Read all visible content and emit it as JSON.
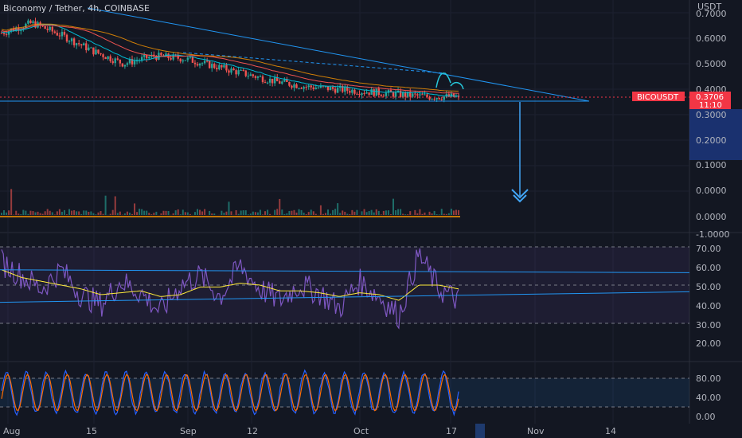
{
  "header": {
    "title": "Biconomy / Tether, 4h, COINBASE"
  },
  "price_axis": {
    "unit": "USDT",
    "ticks": [
      "0.7000",
      "0.6000",
      "0.5000",
      "0.4000",
      "0.3000",
      "0.2000",
      "0.1000",
      "0.0000",
      "0.0000",
      "-1.0000"
    ]
  },
  "last_price": {
    "symbol": "BICOUSDT",
    "value": "0.3706",
    "countdown": "11:10"
  },
  "rsi_axis": {
    "ticks": [
      "70.00",
      "60.00",
      "50.00",
      "40.00",
      "30.00",
      "20.00"
    ]
  },
  "stoch_axis": {
    "ticks": [
      "80.00",
      "40.00",
      "0.00"
    ]
  },
  "time_axis": {
    "ticks": [
      "Aug",
      "15",
      "Sep",
      "12",
      "Oct",
      "17",
      "Nov",
      "14"
    ]
  },
  "colors": {
    "background": "#131722",
    "candle_up": "#26a69a",
    "candle_down": "#ef5350",
    "trendline": "#2196f3",
    "price_tag": "#f23645",
    "rsi_line": "#7e57c2",
    "rsi_ma": "#ffeb3b",
    "stoch_k": "#2962ff",
    "stoch_d": "#ff6d00",
    "axis_text": "#b2b5be"
  },
  "chart_data": [
    {
      "type": "candlestick",
      "title": "Biconomy / Tether, 4h, COINBASE",
      "ylabel": "USDT",
      "ylim": [
        0,
        0.7
      ],
      "x": [
        "Aug",
        "15",
        "Sep",
        "12",
        "Oct",
        "17",
        "Nov",
        "14"
      ],
      "series": [
        {
          "name": "BICOUSDT",
          "values": [
            0.62,
            0.66,
            0.61,
            0.55,
            0.5,
            0.53,
            0.52,
            0.49,
            0.46,
            0.43,
            0.41,
            0.4,
            0.39,
            0.38,
            0.37,
            0.3706
          ]
        }
      ],
      "annotations": [
        "0.3706",
        "11:10"
      ]
    },
    {
      "type": "line",
      "ylim": [
        10,
        75
      ],
      "series": [
        {
          "values": [
            62,
            55,
            48,
            58,
            45,
            40,
            52,
            46,
            36,
            50,
            55,
            44,
            60,
            48,
            42,
            50,
            46,
            38,
            52,
            44,
            34,
            66,
            48,
            42
          ]
        },
        {
          "values": [
            58,
            54,
            52,
            50,
            48,
            45,
            46,
            47,
            44,
            45,
            49,
            49,
            51,
            50,
            47,
            47,
            46,
            44,
            46,
            45,
            42,
            50,
            50,
            48
          ]
        }
      ]
    },
    {
      "type": "line",
      "ylim": [
        0,
        100
      ],
      "series": [
        {
          "values": [
            80,
            20,
            85,
            10,
            90,
            15,
            70,
            30,
            88,
            5,
            60,
            80,
            10,
            90,
            20,
            75,
            5,
            85,
            30,
            90,
            10,
            80,
            5,
            10
          ]
        },
        {
          "values": [
            70,
            35,
            75,
            20,
            80,
            25,
            65,
            35,
            80,
            15,
            55,
            75,
            20,
            80,
            30,
            70,
            15,
            78,
            35,
            82,
            20,
            75,
            15,
            12
          ]
        }
      ]
    }
  ]
}
